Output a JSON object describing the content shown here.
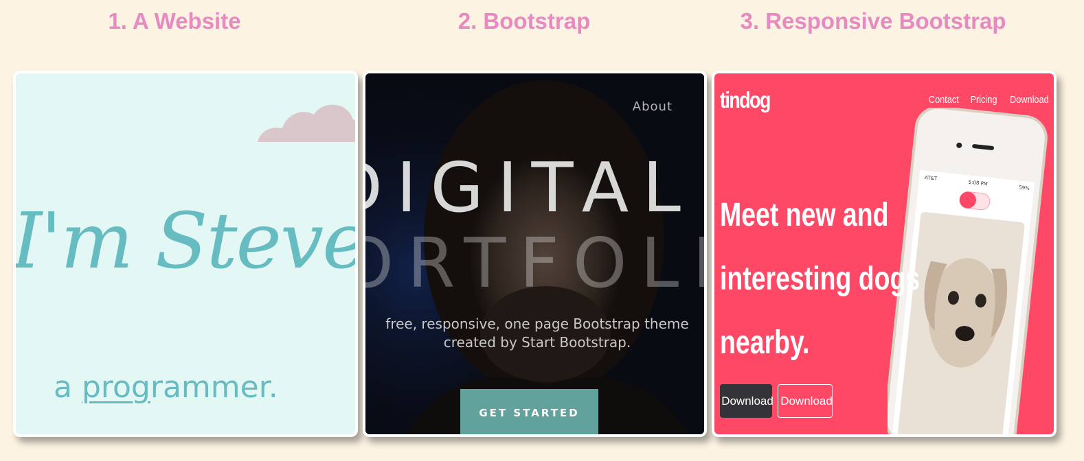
{
  "columns": [
    {
      "title": "1. A Website"
    },
    {
      "title": "2. Bootstrap"
    },
    {
      "title": "3. Responsive Bootstrap"
    }
  ],
  "website": {
    "name_text": "I'm Steven",
    "tagline_prefix": "a ",
    "tagline_underlined": "prog",
    "tagline_suffix": "rammer."
  },
  "bootstrap": {
    "nav_about": "About",
    "hero_line1": "DIGITAL",
    "hero_line2": "PORTFOLIO",
    "subtext_line1": "free, responsive, one page Bootstrap theme",
    "subtext_line2": "created by Start Bootstrap.",
    "cta_label": "GET STARTED"
  },
  "responsive": {
    "brand": "tindog",
    "nav": [
      "Contact",
      "Pricing",
      "Download"
    ],
    "headline_line1": "Meet new and",
    "headline_line2": "interesting dogs",
    "headline_line3": "nearby.",
    "download_apple": "Download",
    "download_google": "Download",
    "phone_time": "5:08 PM",
    "phone_carrier": "AT&T",
    "phone_battery": "59%"
  },
  "colors": {
    "page_bg": "#fdf3e3",
    "title_pink": "#e889c1",
    "mint": "#e3f7f4",
    "teal_text": "#66bcc0",
    "cta_teal": "#62a29c",
    "tindog_red": "#fe4865"
  }
}
